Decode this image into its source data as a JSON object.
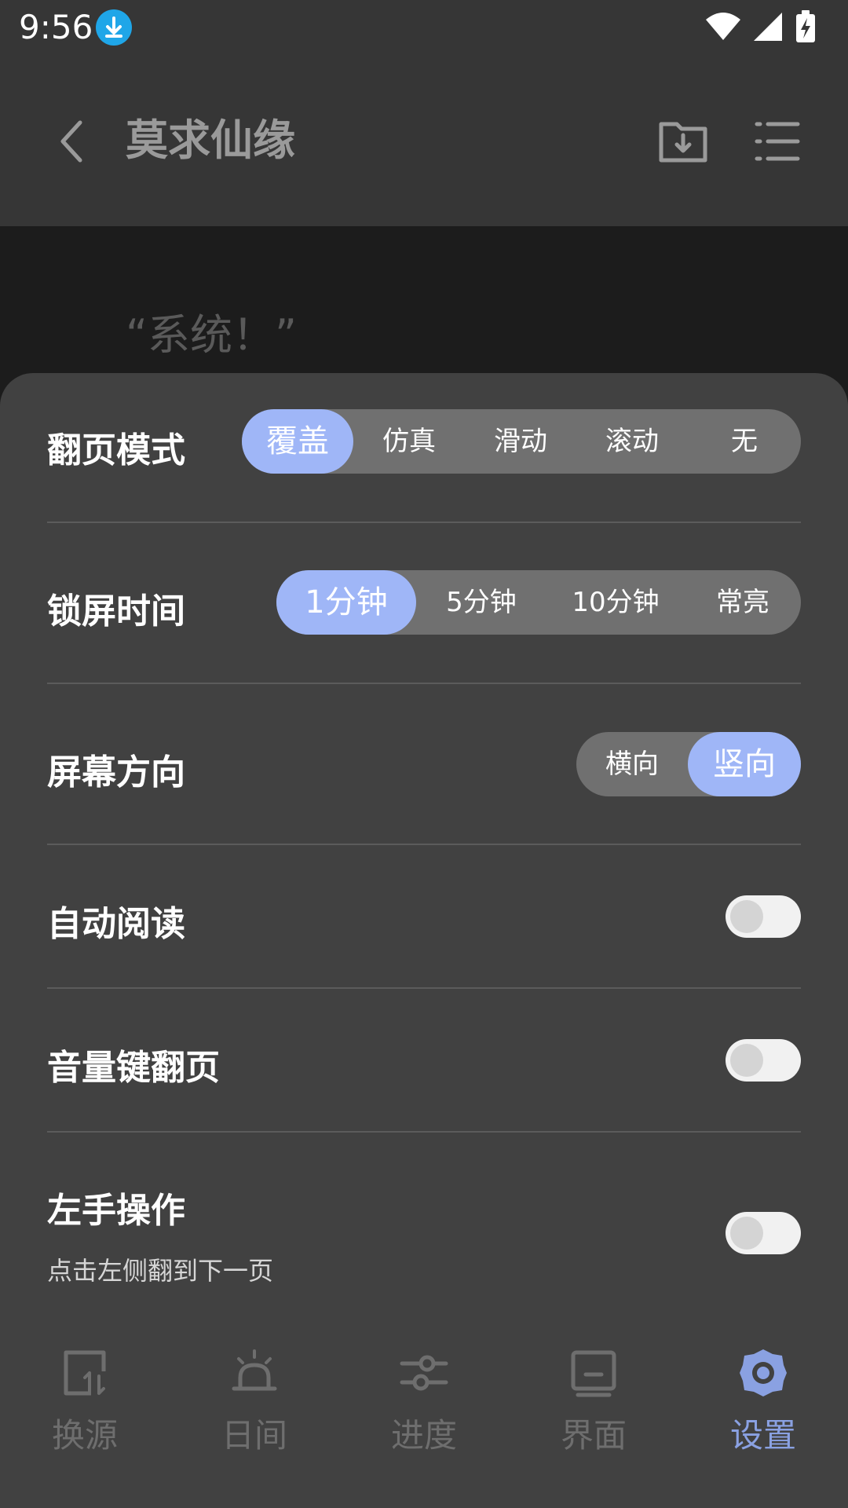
{
  "status": {
    "time": "9:56"
  },
  "header": {
    "title": "莫求仙缘"
  },
  "reader": {
    "text": "“系统！”"
  },
  "settings": {
    "page_mode": {
      "label": "翻页模式",
      "options": [
        "覆盖",
        "仿真",
        "滑动",
        "滚动",
        "无"
      ],
      "selected": "覆盖"
    },
    "lock_time": {
      "label": "锁屏时间",
      "options": [
        "1分钟",
        "5分钟",
        "10分钟",
        "常亮"
      ],
      "selected": "1分钟"
    },
    "orientation": {
      "label": "屏幕方向",
      "options": [
        "横向",
        "竖向"
      ],
      "selected": "竖向"
    },
    "auto_read": {
      "label": "自动阅读",
      "enabled": false
    },
    "volume_keys": {
      "label": "音量键翻页",
      "enabled": false
    },
    "left_hand": {
      "label": "左手操作",
      "hint": "点击左侧翻到下一页",
      "enabled": false
    }
  },
  "nav": {
    "items": [
      {
        "label": "换源",
        "icon": "switch-source-icon"
      },
      {
        "label": "日间",
        "icon": "day-mode-icon"
      },
      {
        "label": "进度",
        "icon": "progress-sliders-icon"
      },
      {
        "label": "界面",
        "icon": "display-icon"
      },
      {
        "label": "设置",
        "icon": "settings-gear-icon",
        "active": true
      }
    ]
  },
  "colors": {
    "accent": "#9fb6f7",
    "nav_active": "#8aa1e2",
    "sheet": "#414141"
  }
}
